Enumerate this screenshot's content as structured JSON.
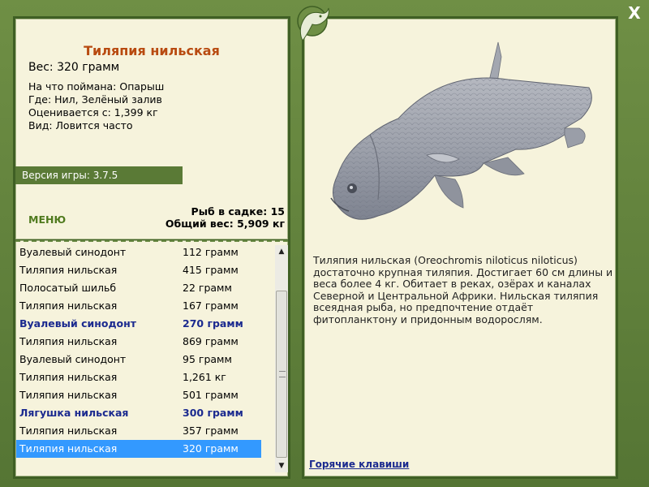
{
  "window": {
    "close_label": "X"
  },
  "fish": {
    "title": "Тиляпия нильская",
    "weight": "Вес: 320 грамм",
    "caught_on": "На что поймана: Опарыш",
    "location": "Где: Нил, Зелёный залив",
    "valued_at": "Оценивается с: 1,399 кг",
    "frequency": "Вид: Ловится часто"
  },
  "version": "Версия игры: 3.7.5",
  "menu_label": "МЕНЮ",
  "cage": {
    "count": "Рыб в садке: 15",
    "total_weight": "Общий вес: 5,909 кг"
  },
  "catch_list": [
    {
      "name": "Вуалевый синодонт",
      "weight": "112 грамм",
      "style": "normal"
    },
    {
      "name": "Тиляпия нильская",
      "weight": "415 грамм",
      "style": "normal"
    },
    {
      "name": "Полосатый шильб",
      "weight": "22 грамм",
      "style": "normal"
    },
    {
      "name": "Тиляпия нильская",
      "weight": "167 грамм",
      "style": "normal"
    },
    {
      "name": "Вуалевый синодонт",
      "weight": "270 грамм",
      "style": "bold"
    },
    {
      "name": "Тиляпия нильская",
      "weight": "869 грамм",
      "style": "normal"
    },
    {
      "name": "Вуалевый синодонт",
      "weight": "95 грамм",
      "style": "normal"
    },
    {
      "name": "Тиляпия нильская",
      "weight": "1,261 кг",
      "style": "normal"
    },
    {
      "name": "Тиляпия нильская",
      "weight": "501 грамм",
      "style": "normal"
    },
    {
      "name": "Лягушка нильская",
      "weight": "300 грамм",
      "style": "bold"
    },
    {
      "name": "Тиляпия нильская",
      "weight": "357 грамм",
      "style": "normal"
    },
    {
      "name": "Тиляпия нильская",
      "weight": "320 грамм",
      "style": "selected"
    }
  ],
  "description": "Тиляпия нильская (Oreochromis niloticus niloticus) достаточно крупная тиляпия. Достигает 60 см длины и веса более 4 кг. Обитает в реках, озёрах и каналах Северной и Центральной Африки. Нильская тиляпия всеядная рыба, но предпочтение отдаёт фитопланктону и придонным водорослям.",
  "hotkeys_label": "Горячие клавиши",
  "icons": {
    "close": "close-icon",
    "logo": "fish-logo-icon",
    "scroll_up": "scroll-up-icon",
    "scroll_down": "scroll-down-icon"
  },
  "colors": {
    "frame": "#5f7f3a",
    "panel": "#f6f3dc",
    "title": "#b84a10",
    "bold_row": "#1b2a8f",
    "selected_row": "#3399ff"
  }
}
